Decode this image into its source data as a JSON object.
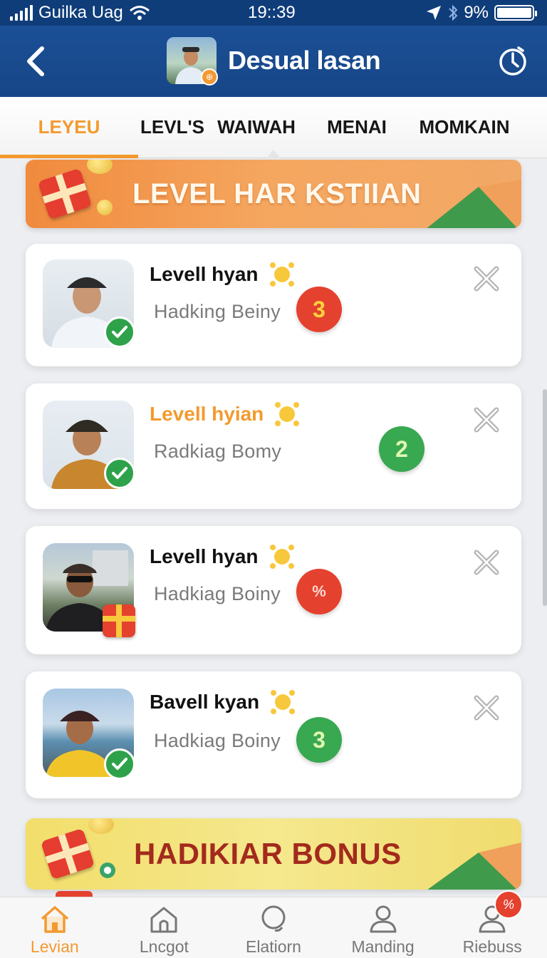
{
  "status_bar": {
    "carrier": "Guilka Uag",
    "time": "19::39",
    "battery": "9%"
  },
  "header": {
    "title": "Desual lasan"
  },
  "tabs": [
    {
      "label": "LEYEU",
      "active": true
    },
    {
      "label": "LEVL'S",
      "active": false
    },
    {
      "label": "WAIWAH",
      "active": false
    },
    {
      "label": "MENAI",
      "active": false
    },
    {
      "label": "MOMKAIN",
      "active": false
    }
  ],
  "banner_top": {
    "text": "LEVEL HAR KSTIIAN"
  },
  "cards": [
    {
      "name": "Levell hyan",
      "subtitle": "Hadking Beiny",
      "count": "3",
      "count_color": "red",
      "name_color": "#111111",
      "badge": "check"
    },
    {
      "name": "Levell hyian",
      "subtitle": "Radkiag Bomy",
      "count": "2",
      "count_color": "green",
      "name_color": "#f39a2f",
      "badge": "check"
    },
    {
      "name": "Levell hyan",
      "subtitle": "Hadkiag Boiny",
      "count": "%",
      "count_color": "red",
      "name_color": "#111111",
      "badge": "gift"
    },
    {
      "name": "Bavell kyan",
      "subtitle": "Hadkiag Boiny",
      "count": "3",
      "count_color": "green",
      "name_color": "#111111",
      "badge": "check"
    }
  ],
  "banner_bottom": {
    "text": "HADIKIAR BONUS"
  },
  "bottom_nav": [
    {
      "label": "Levian",
      "icon": "home-icon",
      "active": true
    },
    {
      "label": "Lncgot",
      "icon": "home-outline-icon",
      "active": false
    },
    {
      "label": "Elatiorn",
      "icon": "search-icon",
      "active": false
    },
    {
      "label": "Manding",
      "icon": "person-icon",
      "active": false
    },
    {
      "label": "Riebuss",
      "icon": "person-icon",
      "active": false,
      "badge": "%"
    }
  ],
  "colors": {
    "header_blue": "#174687",
    "accent_orange": "#f39a2f",
    "badge_red": "#e5412f",
    "badge_green": "#38a851"
  }
}
